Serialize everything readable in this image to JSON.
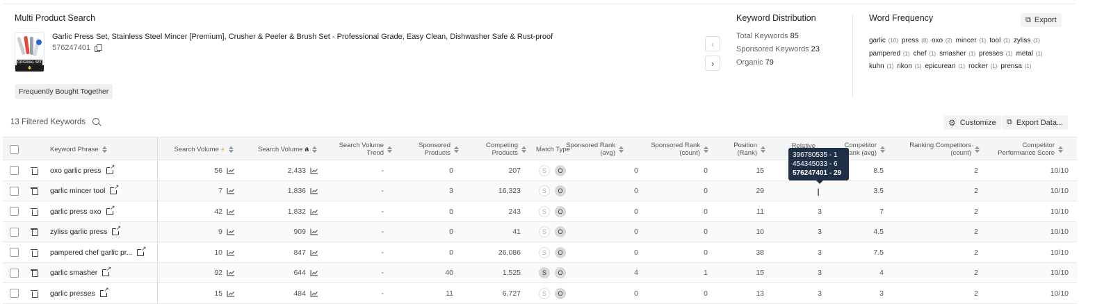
{
  "header": {
    "title": "Multi Product Search",
    "product_title": "Garlic Press Set, Stainless Steel Mincer [Premium], Crusher & Peeler & Brush Set - Professional Grade, Easy Clean, Dishwasher Safe & Rust-proof",
    "asin": "576247401",
    "thumb_label": "ORIGINAL SET",
    "thumb_mark": "✱",
    "frequently_bought_label": "Frequently Bought Together"
  },
  "keyword_distribution": {
    "title": "Keyword Distribution",
    "total_label": "Total Keywords",
    "total_value": "85",
    "sponsored_label": "Sponsored Keywords",
    "sponsored_value": "23",
    "organic_label": "Organic",
    "organic_value": "79"
  },
  "word_frequency": {
    "title": "Word Frequency",
    "export_label": "Export",
    "lines": [
      [
        {
          "w": "garlic",
          "c": "(10)"
        },
        {
          "w": "press",
          "c": "(8)"
        },
        {
          "w": "oxo",
          "c": "(2)"
        },
        {
          "w": "mincer",
          "c": "(1)"
        },
        {
          "w": "tool",
          "c": "(1)"
        },
        {
          "w": "zyliss",
          "c": "(1)"
        }
      ],
      [
        {
          "w": "pampered",
          "c": "(1)"
        },
        {
          "w": "chef",
          "c": "(1)"
        },
        {
          "w": "smasher",
          "c": "(1)"
        },
        {
          "w": "presses",
          "c": "(1)"
        },
        {
          "w": "metal",
          "c": "(1)"
        }
      ],
      [
        {
          "w": "kuhn",
          "c": "(1)"
        },
        {
          "w": "rikon",
          "c": "(1)"
        },
        {
          "w": "epicurean",
          "c": "(1)"
        },
        {
          "w": "rocker",
          "c": "(1)"
        },
        {
          "w": "prensa",
          "c": "(1)"
        }
      ]
    ]
  },
  "toolbar": {
    "filtered_label": "13 Filtered Keywords",
    "customize_label": "Customize",
    "export_data_label": "Export Data..."
  },
  "columns": {
    "keyword_phrase": "Keyword Phrase",
    "search_volume_1": "Search Volume",
    "search_volume_2": "Search Volume",
    "sv_trend_1": "Search Volume",
    "sv_trend_2": "Trend",
    "sp_1": "Sponsored",
    "sp_2": "Products",
    "cp_1": "Competing",
    "cp_2": "Products",
    "match_type": "Match Type",
    "sra_1": "Sponsored Rank",
    "sra_2": "(avg)",
    "src_1": "Sponsored Rank",
    "src_2": "(count)",
    "pos_1": "Position",
    "pos_2": "(Rank)",
    "rel_1": "Relative",
    "cra_1": "Competitor",
    "cra_2": "Rank (avg)",
    "rc_1": "Ranking Competitors",
    "rc_2": "(count)",
    "cps_1": "Competitor",
    "cps_2": "Performance Score"
  },
  "rows": [
    {
      "keyword": "oxo garlic press",
      "sv1": "56",
      "sv2": "2,433",
      "trend": "-",
      "sp": "0",
      "cp": "207",
      "s_on": false,
      "o_on": true,
      "sra": "0",
      "src": "0",
      "pos": "15",
      "rel": "",
      "cra": "8.5",
      "rc": "2",
      "cps": "10/10"
    },
    {
      "keyword": "garlic mincer tool",
      "sv1": "7",
      "sv2": "1,836",
      "trend": "-",
      "sp": "3",
      "cp": "16,323",
      "s_on": false,
      "o_on": true,
      "sra": "0",
      "src": "0",
      "pos": "29",
      "rel": "",
      "cra": "3.5",
      "rc": "2",
      "cps": "10/10"
    },
    {
      "keyword": "garlic press oxo",
      "sv1": "42",
      "sv2": "1,832",
      "trend": "-",
      "sp": "0",
      "cp": "243",
      "s_on": false,
      "o_on": true,
      "sra": "0",
      "src": "0",
      "pos": "11",
      "rel": "3",
      "cra": "7",
      "rc": "2",
      "cps": "10/10"
    },
    {
      "keyword": "zyliss garlic press",
      "sv1": "9",
      "sv2": "909",
      "trend": "-",
      "sp": "0",
      "cp": "41",
      "s_on": false,
      "o_on": true,
      "sra": "0",
      "src": "0",
      "pos": "10",
      "rel": "3",
      "cra": "4.5",
      "rc": "2",
      "cps": "10/10"
    },
    {
      "keyword": "pampered chef garlic pr...",
      "sv1": "10",
      "sv2": "847",
      "trend": "-",
      "sp": "0",
      "cp": "26,086",
      "s_on": false,
      "o_on": true,
      "sra": "0",
      "src": "0",
      "pos": "38",
      "rel": "3",
      "cra": "7.5",
      "rc": "2",
      "cps": "10/10"
    },
    {
      "keyword": "garlic smasher",
      "sv1": "92",
      "sv2": "644",
      "trend": "-",
      "sp": "40",
      "cp": "1,525",
      "s_on": true,
      "o_on": true,
      "sra": "4",
      "src": "1",
      "pos": "15",
      "rel": "3",
      "cra": "4",
      "rc": "2",
      "cps": "10/10"
    },
    {
      "keyword": "garlic presses",
      "sv1": "15",
      "sv2": "484",
      "trend": "-",
      "sp": "11",
      "cp": "6,727",
      "s_on": false,
      "o_on": true,
      "sra": "0",
      "src": "0",
      "pos": "13",
      "rel": "3",
      "cra": "3",
      "rc": "2",
      "cps": "10/10"
    }
  ],
  "match_labels": {
    "s": "S",
    "o": "O"
  },
  "tooltip": {
    "line1": "396780535 - 1",
    "line2": "454345033 - 6",
    "line3": "576247401 - 29"
  }
}
